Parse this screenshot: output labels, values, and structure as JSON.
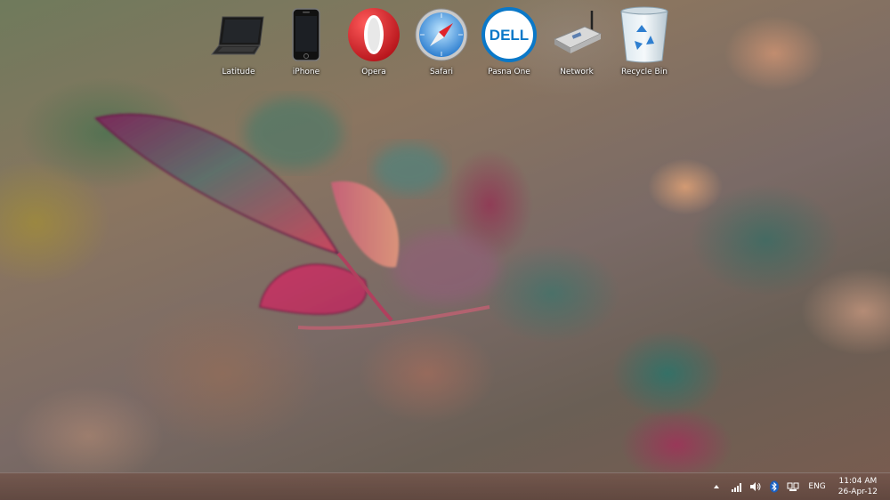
{
  "desktop": {
    "icons": [
      {
        "label": "Latitude",
        "icon": "laptop-icon"
      },
      {
        "label": "iPhone",
        "icon": "phone-icon"
      },
      {
        "label": "Opera",
        "icon": "opera-icon"
      },
      {
        "label": "Safari",
        "icon": "safari-icon"
      },
      {
        "label": "Pasna One",
        "icon": "dell-icon"
      },
      {
        "label": "Network",
        "icon": "router-icon"
      },
      {
        "label": "Recycle Bin",
        "icon": "recycle-bin-icon"
      }
    ],
    "dell_logo_text": "DELL"
  },
  "taskbar": {
    "tray_icons": [
      "show-hidden-icons-arrow",
      "signal-icon",
      "volume-icon",
      "bluetooth-icon",
      "network-icon"
    ],
    "language": "ENG",
    "time": "11:04 AM",
    "date": "26-Apr-12"
  },
  "colors": {
    "taskbar": "#6e5247",
    "label_text": "#ffffff",
    "opera_red": "#d41a1f",
    "dell_blue": "#0a78c8"
  }
}
